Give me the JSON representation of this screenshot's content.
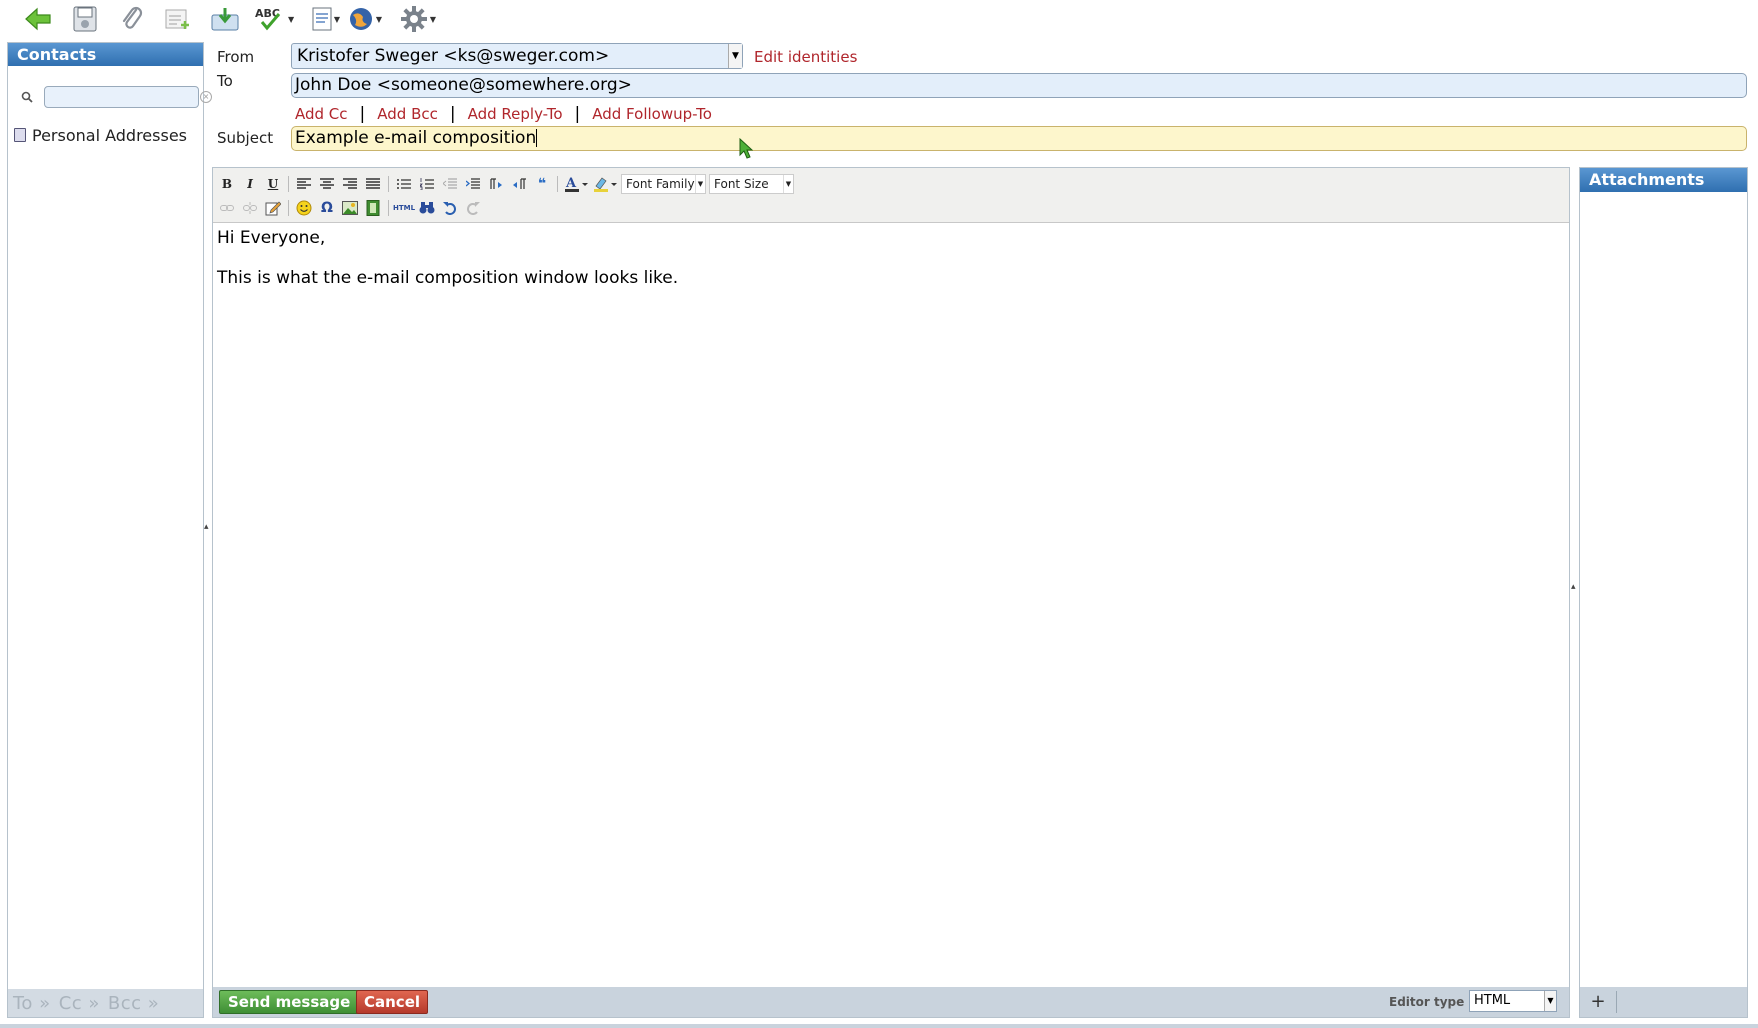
{
  "toolbar": {
    "buttons": [
      {
        "name": "back-button",
        "icon": "arrow-left-icon"
      },
      {
        "name": "save-button",
        "icon": "floppy-disk-icon"
      },
      {
        "name": "attach-button",
        "icon": "paperclip-icon"
      },
      {
        "name": "signature-button",
        "icon": "signature-icon"
      },
      {
        "name": "import-button",
        "icon": "download-box-icon"
      },
      {
        "name": "spellcheck-button",
        "icon": "spellcheck-icon"
      },
      {
        "name": "responses-button",
        "icon": "document-icon"
      },
      {
        "name": "enigma-button",
        "icon": "globe-icon"
      },
      {
        "name": "options-button",
        "icon": "gear-icon"
      }
    ],
    "spellcheck_label": "ABC"
  },
  "contacts": {
    "title": "Contacts",
    "search_value": "",
    "addressbooks": [
      "Personal Addresses"
    ],
    "footer": {
      "to": "To »",
      "cc": "Cc »",
      "bcc": "Bcc »"
    }
  },
  "headers": {
    "from_label": "From",
    "from_value": "Kristofer Sweger <ks@sweger.com>",
    "edit_identities": "Edit identities",
    "to_label": "To",
    "to_value": "John Doe <someone@somewhere.org>",
    "add_links": {
      "cc": "Add Cc",
      "bcc": "Add Bcc",
      "reply_to": "Add Reply-To",
      "followup_to": "Add Followup-To",
      "separator": "|"
    },
    "subject_label": "Subject",
    "subject_value": "Example e-mail composition"
  },
  "editor": {
    "font_family": "Font Family",
    "font_size": "Font Size",
    "bold": "B",
    "italic": "I",
    "underline": "U",
    "body": {
      "greeting": "Hi Everyone,",
      "line": "This is what the e-mail composition window looks like."
    },
    "send_button": "Send message",
    "cancel_button": "Cancel",
    "editor_type_label": "Editor type",
    "editor_type_value": "HTML"
  },
  "attachments": {
    "title": "Attachments",
    "add_label": "+"
  },
  "colors": {
    "header_blue": "#3a7fc1",
    "link_red": "#b0262c",
    "subject_yellow": "#fdf6cc",
    "field_blue": "#e3eefa",
    "send_green": "#4aa04a",
    "cancel_red": "#cc4b3c"
  }
}
